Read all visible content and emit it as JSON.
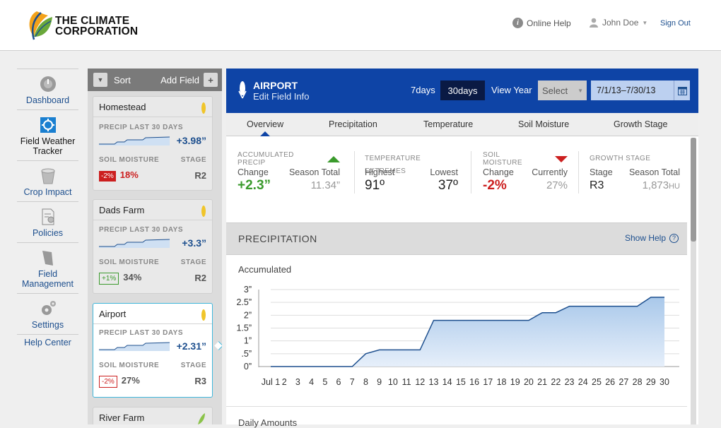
{
  "header": {
    "logo_line1": "THE CLIMATE",
    "logo_line2": "CORPORATION",
    "help": "Online Help",
    "user": "John Doe",
    "signout": "Sign Out"
  },
  "nav": [
    {
      "label": "Dashboard"
    },
    {
      "label": "Field Weather Tracker"
    },
    {
      "label": "Crop Impact"
    },
    {
      "label": "Policies"
    },
    {
      "label": "Field Management"
    },
    {
      "label": "Settings"
    },
    {
      "label": "Help Center"
    }
  ],
  "fields_panel": {
    "sort": "Sort",
    "add_field": "Add Field",
    "precip_label": "PRECIP LAST 30 DAYS",
    "soil_label": "SOIL MOISTURE",
    "stage_label": "STAGE",
    "cards": [
      {
        "name": "Homestead",
        "precip": "+3.98”",
        "badge": "-2%",
        "moisture": "18%",
        "stage": "R2"
      },
      {
        "name": "Dads Farm",
        "precip": "+3.3”",
        "badge": "+1%",
        "moisture": "34%",
        "stage": "R2"
      },
      {
        "name": "Airport",
        "precip": "+2.31”",
        "badge": "-2%",
        "moisture": "27%",
        "stage": "R3"
      },
      {
        "name": "River Farm"
      }
    ]
  },
  "field_header": {
    "name": "AIRPORT",
    "edit": "Edit Field Info",
    "range_7": "7days",
    "range_30": "30days",
    "view_year": "View Year",
    "select": "Select",
    "dates": "7/1/13–7/30/13"
  },
  "tabs": [
    "Overview",
    "Precipitation",
    "Temperature",
    "Soil Moisture",
    "Growth Stage"
  ],
  "stats": {
    "precip": {
      "title": "ACCUMULATED PRECIP",
      "l1": "Change",
      "l2": "Season Total",
      "v1": "+2.3”",
      "v2": "11.34”"
    },
    "temp": {
      "title": "TEMPERATURE EXTREMES",
      "l1": "Highest",
      "l2": "Lowest",
      "v1": "91º",
      "v2": "37º"
    },
    "soil": {
      "title": "SOIL MOISTURE",
      "l1": "Change",
      "l2": "Currently",
      "v1": "-2%",
      "v2": "27%"
    },
    "growth": {
      "title": "GROWTH STAGE",
      "l1": "Stage",
      "l2": "Season Total",
      "v1": "R3",
      "v2": "1,873",
      "v2_unit": "HU"
    }
  },
  "section": {
    "title": "PRECIPITATION",
    "show_help": "Show Help",
    "next": "Daily Amounts"
  },
  "colors": {
    "brand_blue": "#0e44a6",
    "accent_green": "#3a9a2c",
    "accent_red": "#cc1f1f",
    "selected_border": "#3fb6da"
  },
  "chart_data": {
    "type": "area",
    "title": "Accumulated",
    "x": [
      "Jul 1",
      "2",
      "3",
      "4",
      "5",
      "6",
      "7",
      "8",
      "9",
      "10",
      "11",
      "12",
      "13",
      "14",
      "15",
      "16",
      "17",
      "18",
      "19",
      "20",
      "21",
      "22",
      "23",
      "24",
      "25",
      "26",
      "27",
      "28",
      "29",
      "30"
    ],
    "y_ticks": [
      "0”",
      ".5”",
      "1”",
      "1.5”",
      "2”",
      "2.5”",
      "3”"
    ],
    "ylim": [
      0,
      3
    ],
    "values": [
      0,
      0,
      0,
      0,
      0,
      0,
      0,
      0.5,
      0.65,
      0.65,
      0.65,
      0.65,
      1.8,
      1.8,
      1.8,
      1.8,
      1.8,
      1.8,
      1.8,
      1.8,
      2.1,
      2.1,
      2.35,
      2.35,
      2.35,
      2.35,
      2.35,
      2.35,
      2.7,
      2.7
    ],
    "grid": true
  }
}
